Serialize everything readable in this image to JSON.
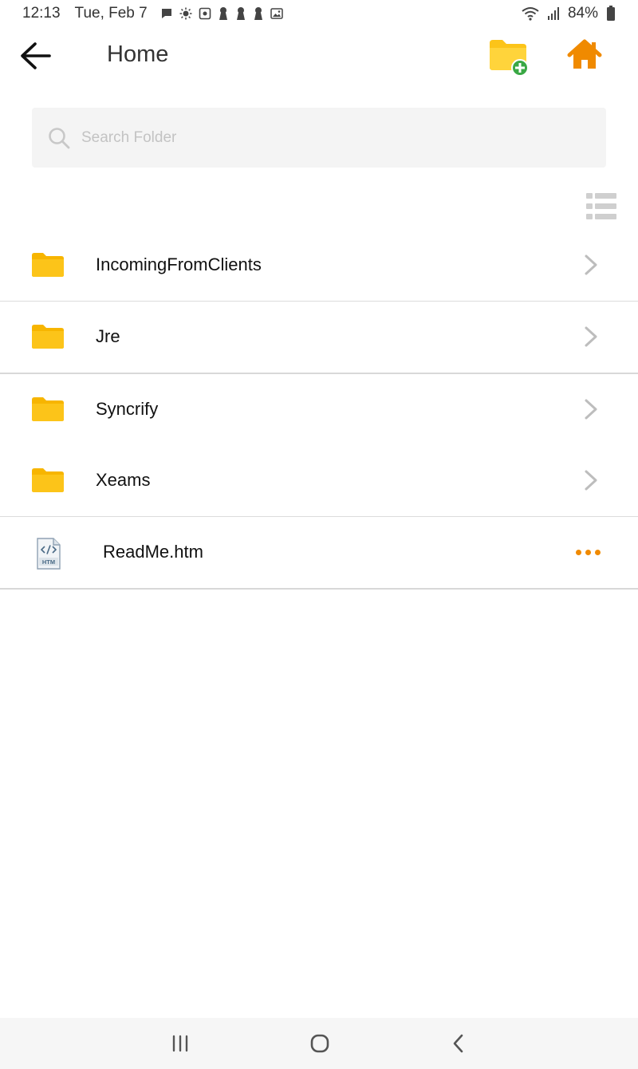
{
  "status_bar": {
    "time": "12:13",
    "date": "Tue, Feb 7",
    "battery": "84%",
    "icons": [
      "chat-icon",
      "brightness-icon",
      "app-icon",
      "keyhole-icon",
      "keyhole-icon",
      "keyhole-icon",
      "image-icon",
      "wifi-icon",
      "signal-icon",
      "battery-icon"
    ]
  },
  "app_bar": {
    "title": "Home",
    "back_icon": "arrow-left-icon",
    "new_folder_icon": "folder-add-icon",
    "home_icon": "home-icon"
  },
  "search": {
    "placeholder": "Search Folder",
    "value": ""
  },
  "view_toggle": {
    "icon": "list-view-icon"
  },
  "items": [
    {
      "name": "IncomingFromClients",
      "type": "folder"
    },
    {
      "name": "Jre",
      "type": "folder"
    },
    {
      "name": "Syncrify",
      "type": "folder"
    },
    {
      "name": "Xeams",
      "type": "folder"
    },
    {
      "name": "ReadMe.htm",
      "type": "file",
      "badge": "HTM"
    }
  ],
  "colors": {
    "accent": "#f08a00",
    "folder": "#fcc419",
    "add_green": "#3aa845"
  },
  "nav_bar": [
    "recents-icon",
    "home-circle-icon",
    "back-chevron-icon"
  ]
}
